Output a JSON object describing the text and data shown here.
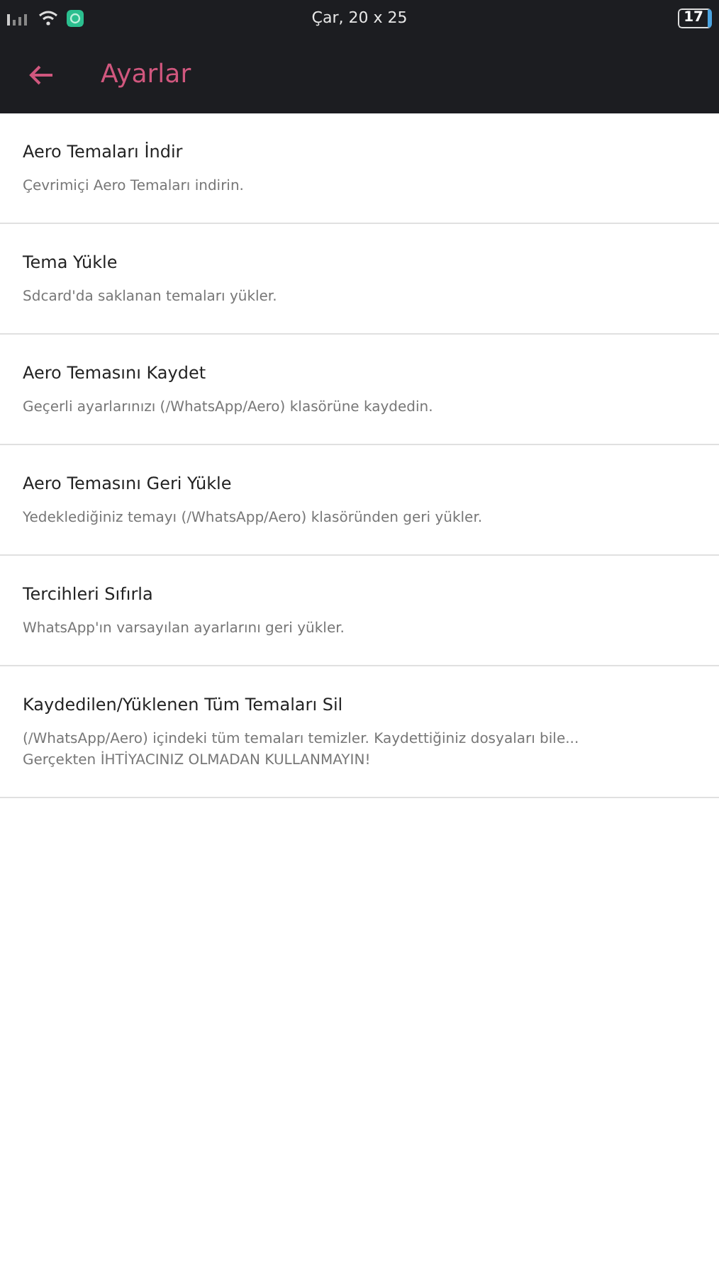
{
  "status_bar": {
    "time": "Çar, 20 x 25",
    "battery": "17"
  },
  "toolbar": {
    "title": "Ayarlar"
  },
  "items": [
    {
      "title": "Aero Temaları İndir",
      "summary_lines": [
        "Çevrimiçi Aero Temaları indirin."
      ]
    },
    {
      "title": "Tema Yükle",
      "summary_lines": [
        "Sdcard'da saklanan temaları yükler."
      ]
    },
    {
      "title": "Aero Temasını Kaydet",
      "summary_lines": [
        "Geçerli ayarlarınızı (/WhatsApp/Aero) klasörüne kaydedin."
      ]
    },
    {
      "title": "Aero Temasını Geri Yükle",
      "summary_lines": [
        "Yedeklediğiniz temayı (/WhatsApp/Aero) klasöründen geri yükler."
      ]
    },
    {
      "title": "Tercihleri Sıfırla",
      "summary_lines": [
        "WhatsApp'ın varsayılan ayarlarını geri yükler."
      ]
    },
    {
      "title": "Kaydedilen/Yüklenen Tüm Temaları Sil",
      "summary_lines": [
        "(/WhatsApp/Aero) içindeki tüm temaları temizler. Kaydettiğiniz dosyaları bile...",
        "Gerçekten İHTİYACINIZ OLMADAN KULLANMAYIN!"
      ]
    }
  ]
}
